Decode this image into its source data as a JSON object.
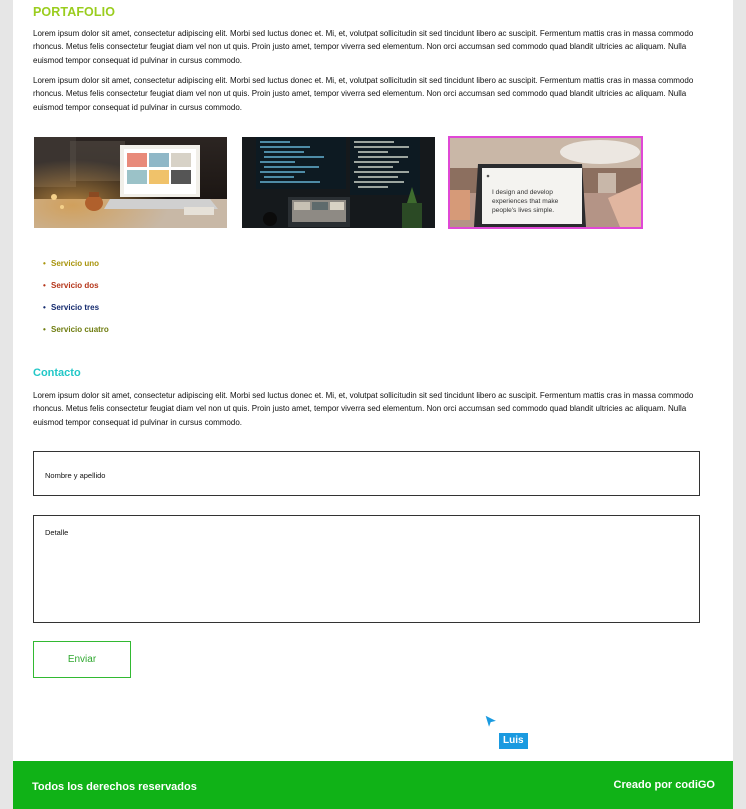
{
  "portfolio": {
    "title": "PORTAFOLIO",
    "paragraph1": "Lorem ipsum dolor sit amet, consectetur adipiscing elit. Morbi sed luctus donec et. Mi, et, volutpat sollicitudin sit sed tincidunt libero ac suscipit. Fermentum mattis cras in massa commodo rhoncus. Metus felis consectetur feugiat diam vel non ut quis. Proin justo amet, tempor viverra sed elementum. Non orci accumsan sed commodo quad blandit ultricies ac aliquam. Nulla euismod tempor consequat id pulvinar in cursus commodo.",
    "paragraph2": "Lorem ipsum dolor sit amet, consectetur adipiscing elit. Morbi sed luctus donec et. Mi, et, volutpat sollicitudin sit sed tincidunt libero ac suscipit. Fermentum mattis cras in massa commodo rhoncus. Metus felis consectetur feugiat diam vel non ut quis. Proin justo amet, tempor viverra sed elementum. Non orci accumsan sed commodo quad blandit ultricies ac aliquam. Nulla euismod tempor consequat id pulvinar in cursus commodo.",
    "image3_caption": [
      "I design and develop",
      "experiences that make",
      "people's lives simple."
    ]
  },
  "services": [
    {
      "label": "Servicio uno",
      "color": "#a8940c"
    },
    {
      "label": "Servicio dos",
      "color": "#b5361a"
    },
    {
      "label": "Servicio tres",
      "color": "#142a6e"
    },
    {
      "label": "Servicio cuatro",
      "color": "#6f7d10"
    }
  ],
  "contact": {
    "title": "Contacto",
    "paragraph": "Lorem ipsum dolor sit amet, consectetur adipiscing elit. Morbi sed luctus donec et. Mi, et, volutpat sollicitudin sit sed tincidunt libero ac suscipit. Fermentum mattis cras in massa commodo rhoncus. Metus felis consectetur feugiat diam vel non ut quis. Proin justo amet, tempor viverra sed elementum. Non orci accumsan sed commodo quad blandit ultricies ac aliquam. Nulla euismod tempor consequat id pulvinar in cursus commodo.",
    "name_placeholder": "Nombre y apellido",
    "detail_placeholder": "Detalle",
    "submit_label": "Enviar"
  },
  "cursor": {
    "user_label": "Luis"
  },
  "footer": {
    "left_text": "Todos los derechos reservados",
    "right_text": "Creado por codiGO"
  },
  "colors": {
    "accent_green": "#10b217",
    "heading_lime": "#9acd1e",
    "heading_teal": "#22c7c7",
    "selection_pink": "#e048d6",
    "cursor_blue": "#1a9ae0"
  }
}
